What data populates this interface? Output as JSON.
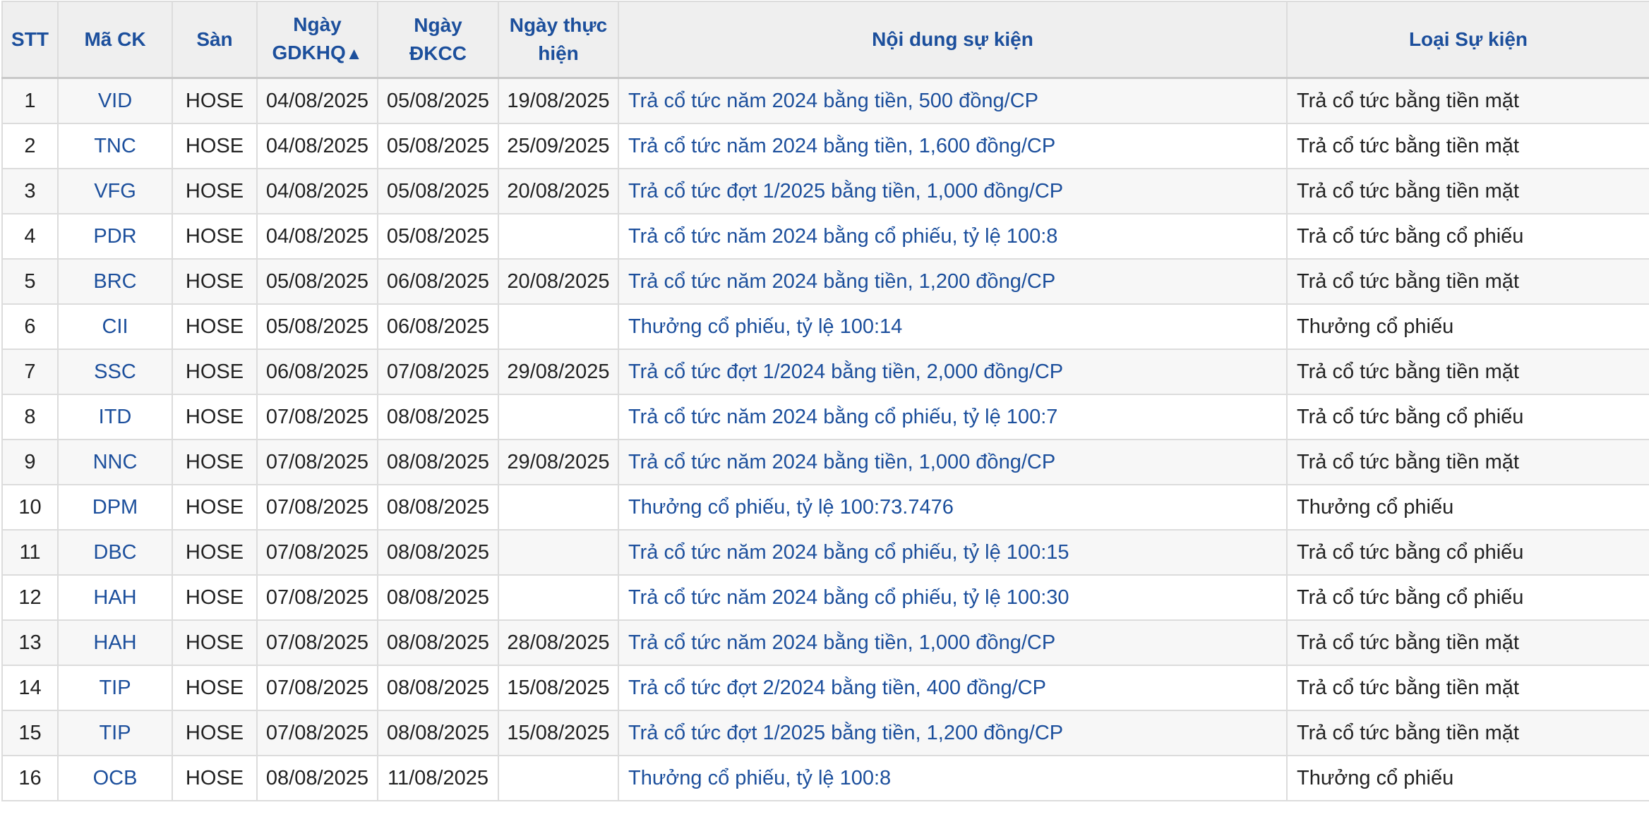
{
  "table": {
    "headers": {
      "stt": "STT",
      "code": "Mã CK",
      "exchange": "Sàn",
      "exdate_line1": "Ngày",
      "exdate_line2": "GDKHQ",
      "exdate_sort": "▲",
      "recdate_line1": "Ngày",
      "recdate_line2": "ĐKCC",
      "paydate_line1": "Ngày thực",
      "paydate_line2": "hiện",
      "content": "Nội dung sự kiện",
      "type": "Loại Sự kiện"
    },
    "rows": [
      {
        "stt": "1",
        "code": "VID",
        "exchange": "HOSE",
        "exdate": "04/08/2025",
        "recdate": "05/08/2025",
        "paydate": "19/08/2025",
        "content": "Trả cổ tức năm 2024 bằng tiền, 500 đồng/CP",
        "type": "Trả cổ tức bằng tiền mặt"
      },
      {
        "stt": "2",
        "code": "TNC",
        "exchange": "HOSE",
        "exdate": "04/08/2025",
        "recdate": "05/08/2025",
        "paydate": "25/09/2025",
        "content": "Trả cổ tức năm 2024 bằng tiền, 1,600 đồng/CP",
        "type": "Trả cổ tức bằng tiền mặt"
      },
      {
        "stt": "3",
        "code": "VFG",
        "exchange": "HOSE",
        "exdate": "04/08/2025",
        "recdate": "05/08/2025",
        "paydate": "20/08/2025",
        "content": "Trả cổ tức đợt 1/2025 bằng tiền, 1,000 đồng/CP",
        "type": "Trả cổ tức bằng tiền mặt"
      },
      {
        "stt": "4",
        "code": "PDR",
        "exchange": "HOSE",
        "exdate": "04/08/2025",
        "recdate": "05/08/2025",
        "paydate": "",
        "content": "Trả cổ tức năm 2024 bằng cổ phiếu, tỷ lệ 100:8",
        "type": "Trả cổ tức bằng cổ phiếu"
      },
      {
        "stt": "5",
        "code": "BRC",
        "exchange": "HOSE",
        "exdate": "05/08/2025",
        "recdate": "06/08/2025",
        "paydate": "20/08/2025",
        "content": "Trả cổ tức năm 2024 bằng tiền, 1,200 đồng/CP",
        "type": "Trả cổ tức bằng tiền mặt"
      },
      {
        "stt": "6",
        "code": "CII",
        "exchange": "HOSE",
        "exdate": "05/08/2025",
        "recdate": "06/08/2025",
        "paydate": "",
        "content": "Thưởng cổ phiếu, tỷ lệ 100:14",
        "type": "Thưởng cổ phiếu"
      },
      {
        "stt": "7",
        "code": "SSC",
        "exchange": "HOSE",
        "exdate": "06/08/2025",
        "recdate": "07/08/2025",
        "paydate": "29/08/2025",
        "content": "Trả cổ tức đợt 1/2024 bằng tiền, 2,000 đồng/CP",
        "type": "Trả cổ tức bằng tiền mặt"
      },
      {
        "stt": "8",
        "code": "ITD",
        "exchange": "HOSE",
        "exdate": "07/08/2025",
        "recdate": "08/08/2025",
        "paydate": "",
        "content": "Trả cổ tức năm 2024 bằng cổ phiếu, tỷ lệ 100:7",
        "type": "Trả cổ tức bằng cổ phiếu"
      },
      {
        "stt": "9",
        "code": "NNC",
        "exchange": "HOSE",
        "exdate": "07/08/2025",
        "recdate": "08/08/2025",
        "paydate": "29/08/2025",
        "content": "Trả cổ tức năm 2024 bằng tiền, 1,000 đồng/CP",
        "type": "Trả cổ tức bằng tiền mặt"
      },
      {
        "stt": "10",
        "code": "DPM",
        "exchange": "HOSE",
        "exdate": "07/08/2025",
        "recdate": "08/08/2025",
        "paydate": "",
        "content": "Thưởng cổ phiếu, tỷ lệ 100:73.7476",
        "type": "Thưởng cổ phiếu"
      },
      {
        "stt": "11",
        "code": "DBC",
        "exchange": "HOSE",
        "exdate": "07/08/2025",
        "recdate": "08/08/2025",
        "paydate": "",
        "content": "Trả cổ tức năm 2024 bằng cổ phiếu, tỷ lệ 100:15",
        "type": "Trả cổ tức bằng cổ phiếu"
      },
      {
        "stt": "12",
        "code": "HAH",
        "exchange": "HOSE",
        "exdate": "07/08/2025",
        "recdate": "08/08/2025",
        "paydate": "",
        "content": "Trả cổ tức năm 2024 bằng cổ phiếu, tỷ lệ 100:30",
        "type": "Trả cổ tức bằng cổ phiếu"
      },
      {
        "stt": "13",
        "code": "HAH",
        "exchange": "HOSE",
        "exdate": "07/08/2025",
        "recdate": "08/08/2025",
        "paydate": "28/08/2025",
        "content": "Trả cổ tức năm 2024 bằng tiền, 1,000 đồng/CP",
        "type": "Trả cổ tức bằng tiền mặt"
      },
      {
        "stt": "14",
        "code": "TIP",
        "exchange": "HOSE",
        "exdate": "07/08/2025",
        "recdate": "08/08/2025",
        "paydate": "15/08/2025",
        "content": "Trả cổ tức đợt 2/2024 bằng tiền, 400 đồng/CP",
        "type": "Trả cổ tức bằng tiền mặt"
      },
      {
        "stt": "15",
        "code": "TIP",
        "exchange": "HOSE",
        "exdate": "07/08/2025",
        "recdate": "08/08/2025",
        "paydate": "15/08/2025",
        "content": "Trả cổ tức đợt 1/2025 bằng tiền, 1,200 đồng/CP",
        "type": "Trả cổ tức bằng tiền mặt"
      },
      {
        "stt": "16",
        "code": "OCB",
        "exchange": "HOSE",
        "exdate": "08/08/2025",
        "recdate": "11/08/2025",
        "paydate": "",
        "content": "Thưởng cổ phiếu, tỷ lệ 100:8",
        "type": "Thưởng cổ phiếu"
      }
    ]
  },
  "colors": {
    "link": "#1c4f9c",
    "header_bg": "#efefef",
    "border": "#dcdcdc",
    "text": "#222222"
  }
}
